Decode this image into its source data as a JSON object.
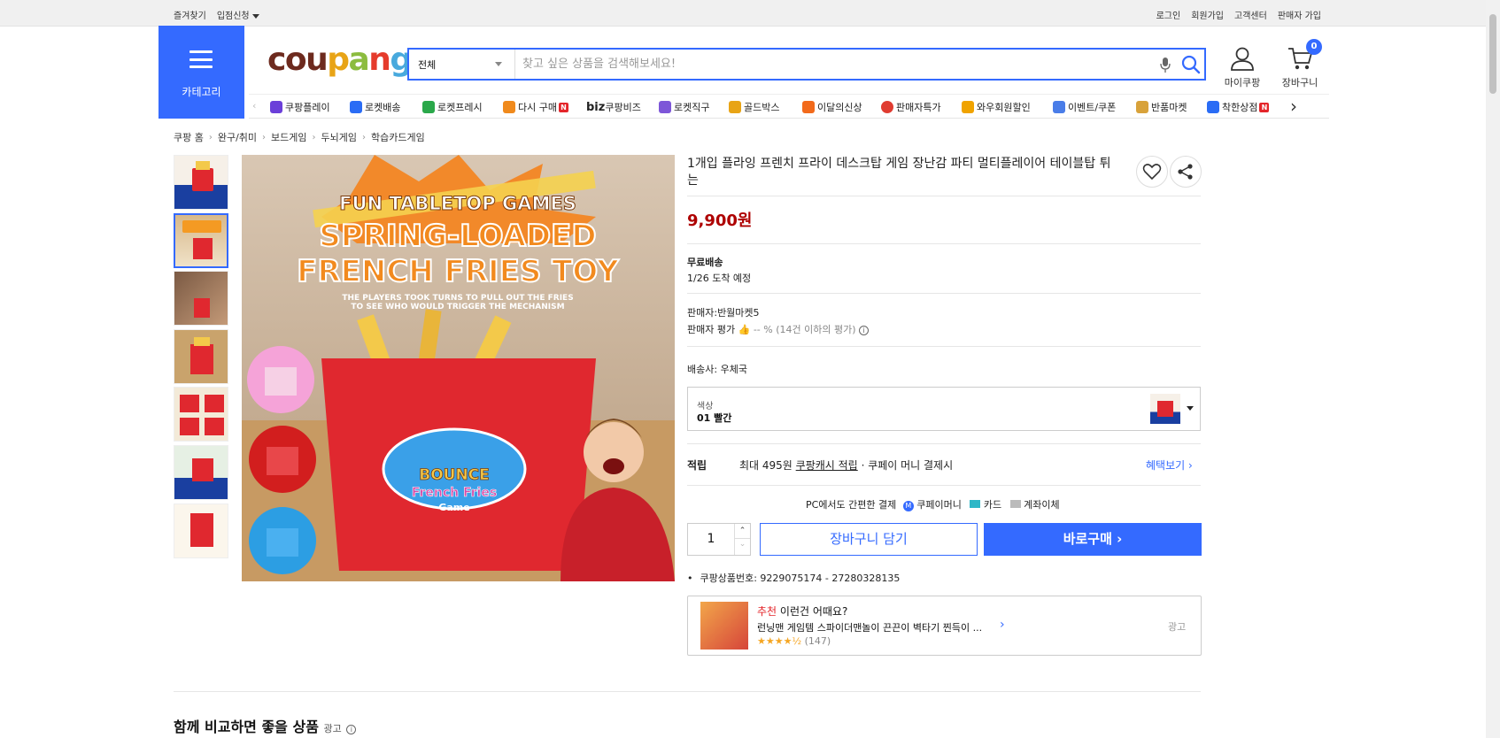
{
  "topbar": {
    "left": [
      "즐겨찾기",
      "입점신청"
    ],
    "right": [
      "로그인",
      "회원가입",
      "고객센터",
      "판매자 가입"
    ]
  },
  "category_label": "카테고리",
  "logo": {
    "text": "coupang"
  },
  "search": {
    "scope": "전체",
    "placeholder": "찾고 싶은 상품을 검색해보세요!"
  },
  "account": {
    "my": "마이쿠팡",
    "cart": "장바구니",
    "cart_count": "0"
  },
  "nav": [
    {
      "label": "쿠팡플레이",
      "color": "#6b3fd9"
    },
    {
      "label": "로켓배송",
      "color": "#2a6cf5"
    },
    {
      "label": "로켓프레시",
      "color": "#2aa84a"
    },
    {
      "label": "다시 구매",
      "color": "#f08a1c",
      "badge": "N"
    },
    {
      "label": "쿠팡비즈",
      "prefix": "biz"
    },
    {
      "label": "로켓직구",
      "color": "#7d56d8"
    },
    {
      "label": "골드박스",
      "color": "#e8a416"
    },
    {
      "label": "이달의신상",
      "color": "#f26a1b"
    },
    {
      "label": "판매자특가",
      "color": "#e03c31"
    },
    {
      "label": "와우회원할인",
      "color": "#f0a300"
    },
    {
      "label": "이벤트/쿠폰",
      "color": "#4a7de8"
    },
    {
      "label": "반품마켓",
      "color": "#d8a23a"
    },
    {
      "label": "착한상점",
      "color": "#2a6cf5",
      "badge": "N"
    }
  ],
  "breadcrumb": [
    "쿠팡 홈",
    "완구/취미",
    "보드게임",
    "두뇌게임",
    "학습카드게임"
  ],
  "product": {
    "title": "1개입 플라잉 프렌치 프라이 데스크탑 게임 장난감 파티 멀티플레이어 테이블탑 튀는",
    "price": "9,900원",
    "shipping_title": "무료배송",
    "arrival": "1/26 도착 예정",
    "seller": "판매자:반월마켓5",
    "seller_rating_label": "판매자 평가",
    "seller_rating": "-- % (14건 이하의 평가)",
    "courier_label": "배송사:",
    "courier": "우체국",
    "option_label": "색상",
    "option_value": "01 빨간",
    "reward_label": "적립",
    "reward_text_a": "최대 495원",
    "reward_text_b": "쿠팡캐시 적립",
    "reward_text_c": "· 쿠페이 머니 결제시",
    "reward_link": "혜택보기",
    "pay_title": "PC에서도 간편한 결제",
    "pay_methods": [
      "쿠페이머니",
      "카드",
      "계좌이체"
    ],
    "quantity": "1",
    "cart_button": "장바구니 담기",
    "buy_button": "바로구매",
    "product_no": "쿠팡상품번호: 9229075174 - 27280328135"
  },
  "image_text": {
    "line1": "FUN TABLETOP GAMES",
    "line2": "SPRING-LOADED",
    "line3": "FRENCH FRIES TOY",
    "line4": "THE PLAYERS TOOK TURNS TO PULL OUT THE FRIES",
    "line5": "TO SEE WHO WOULD TRIGGER THE MECHANISM",
    "box1": "BOUNCE",
    "box2": "French Fries",
    "box3": "Game"
  },
  "recommend": {
    "tag": "추천",
    "headline": "이런건 어때요?",
    "name": "런닝맨 게임템 스파이더맨놀이 끈끈이 벽타기 찐득이 ...",
    "reviews": "(147)",
    "ad": "광고"
  },
  "compare": {
    "title": "함께 비교하면 좋을 상품",
    "ad": "광고"
  },
  "colors": {
    "accent": "#346aff",
    "price": "#ae0000"
  }
}
